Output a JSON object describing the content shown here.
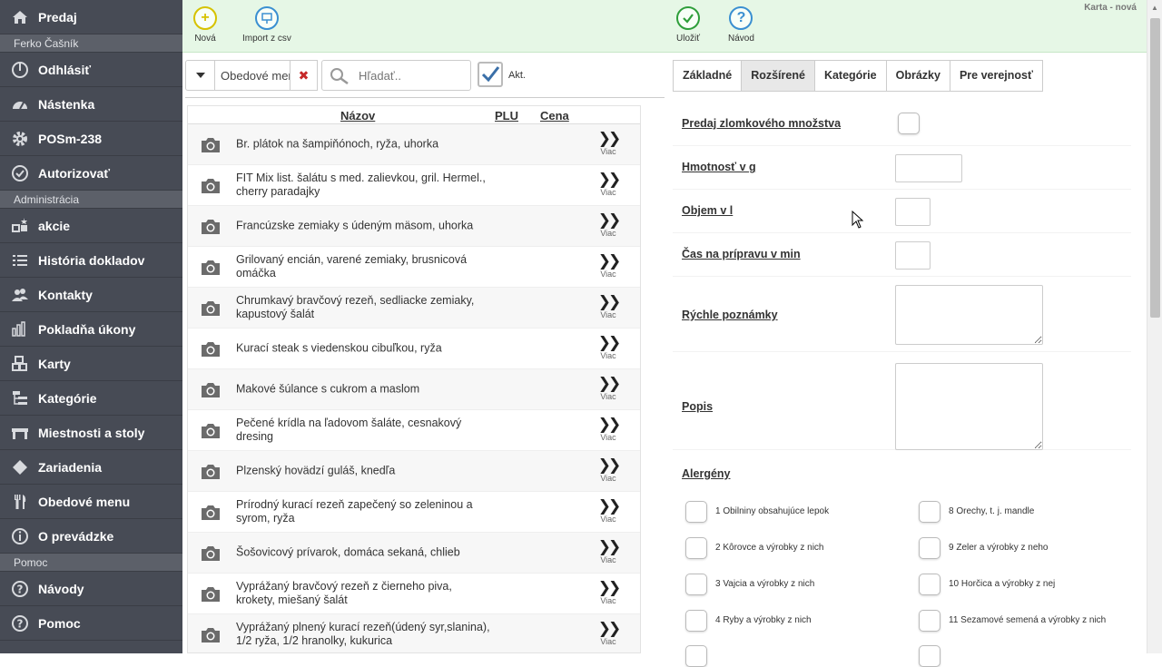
{
  "sidebar": {
    "top_item": {
      "label": "Predaj",
      "icon": "home-icon"
    },
    "user_section": "Ferko Čašník",
    "user_items": [
      {
        "label": "Odhlásiť",
        "icon": "power-icon"
      },
      {
        "label": "Nástenka",
        "icon": "dashboard-icon"
      },
      {
        "label": "POSm-238",
        "icon": "gear-icon"
      },
      {
        "label": "Autorizovať",
        "icon": "check-circle-icon"
      }
    ],
    "admin_section": "Administrácia",
    "admin_items": [
      {
        "label": "akcie",
        "icon": "promo-icon"
      },
      {
        "label": "História dokladov",
        "icon": "list-icon"
      },
      {
        "label": "Kontakty",
        "icon": "users-icon"
      },
      {
        "label": "Pokladňa úkony",
        "icon": "bar-chart-icon"
      },
      {
        "label": "Karty",
        "icon": "boxes-icon"
      },
      {
        "label": "Kategórie",
        "icon": "tree-icon"
      },
      {
        "label": "Miestnosti a stoly",
        "icon": "table-icon"
      },
      {
        "label": "Zariadenia",
        "icon": "diamond-icon"
      },
      {
        "label": "Obedové menu",
        "icon": "cutlery-icon"
      },
      {
        "label": "O prevádzke",
        "icon": "info-icon"
      }
    ],
    "help_section": "Pomoc",
    "help_items": [
      {
        "label": "Návody",
        "icon": "question-icon"
      },
      {
        "label": "Pomoc",
        "icon": "question-icon"
      }
    ]
  },
  "toolbar": {
    "new_label": "Nová",
    "import_label": "Import z csv",
    "save_label": "Uložiť",
    "guide_label": "Návod",
    "status_text": "Karta - nová"
  },
  "filter": {
    "category_value": "Obedové menu",
    "search_placeholder": "Hľadať..",
    "active_label": "Akt.",
    "active_checked": true
  },
  "list": {
    "columns": {
      "name": "Názov",
      "plu": "PLU",
      "price": "Cena"
    },
    "more_label": "Viac",
    "items": [
      "Br. plátok na šampiňónoch, ryža, uhorka",
      "FIT Mix list. šalátu s med. zalievkou, gril. Hermel., cherry paradajky",
      "Francúzske zemiaky s údeným mäsom, uhorka",
      "Grilovaný encián, varené zemiaky, brusnicová omáčka",
      "Chrumkavý bravčový rezeň, sedliacke zemiaky, kapustový šalát",
      "Kurací steak s viedenskou cibuľkou, ryža",
      "Makové šúlance s cukrom a maslom",
      "Pečené krídla na ľadovom šaláte, cesnakový dresing",
      "Plzenský hovädzí guláš, knedľa",
      "Prírodný kurací rezeň zapečený so zeleninou a syrom, ryža",
      "Šošovicový prívarok, domáca sekaná, chlieb",
      "Vyprážaný bravčový rezeň z čierneho piva, krokety, miešaný šalát",
      "Vyprážaný plnený kurací rezeň(údený syr,slanina), 1/2 ryža, 1/2 hranolky, kukurica"
    ]
  },
  "tabs": [
    "Základné",
    "Rozšírené",
    "Kategórie",
    "Obrázky",
    "Pre verejnosť"
  ],
  "active_tab": "Rozšírené",
  "form": {
    "fraction_label": "Predaj zlomkového množstva",
    "weight_label": "Hmotnosť v g",
    "volume_label": "Objem v l",
    "prep_time_label": "Čas na prípravu v min",
    "quick_notes_label": "Rýchle poznámky",
    "description_label": "Popis",
    "allergens_label": "Alergény",
    "allergens": [
      "1 Obilniny obsahujúce lepok",
      "2 Kôrovce a výrobky z nich",
      "3 Vajcia a výrobky z nich",
      "4 Ryby a výrobky z nich",
      "8 Orechy, t. j. mandle",
      "9 Zeler a výrobky z neho",
      "10 Horčica a výrobky z nej",
      "11 Sezamové semená a výrobky z nich"
    ]
  },
  "colors": {
    "sidebar_bg": "#474b55",
    "toolbar_bg": "#e6f7e6",
    "accent_green": "#2e9e3a",
    "accent_blue": "#3a8fd1",
    "accent_yellow": "#d6c200"
  }
}
